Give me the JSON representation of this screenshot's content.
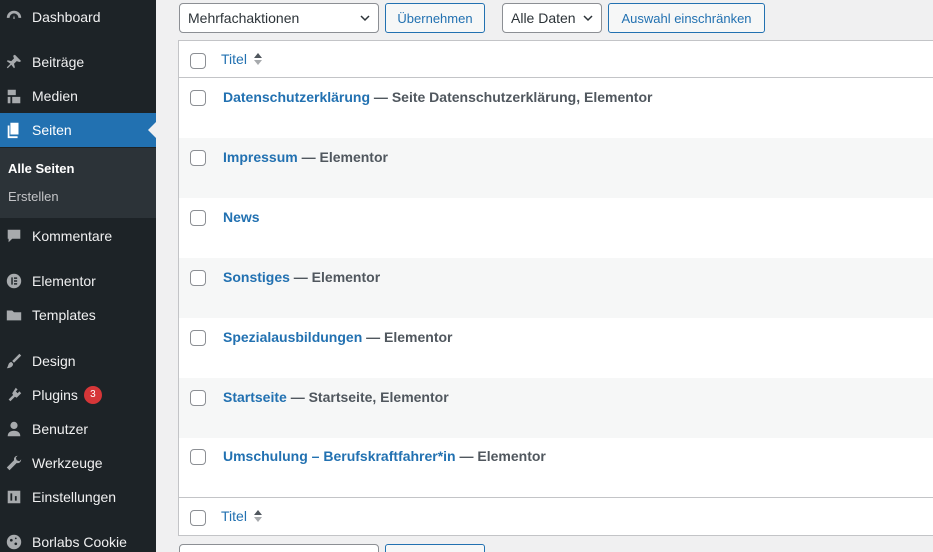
{
  "sidebar": {
    "items": [
      {
        "label": "Dashboard",
        "icon": "dashboard-icon"
      },
      {
        "label": "Beiträge",
        "icon": "pin-icon"
      },
      {
        "label": "Medien",
        "icon": "media-icon"
      },
      {
        "label": "Seiten",
        "icon": "pages-icon",
        "active": true
      },
      {
        "label": "Kommentare",
        "icon": "comment-icon"
      },
      {
        "label": "Elementor",
        "icon": "elementor-icon"
      },
      {
        "label": "Templates",
        "icon": "folder-icon"
      },
      {
        "label": "Design",
        "icon": "brush-icon"
      },
      {
        "label": "Plugins",
        "icon": "plugin-icon",
        "badge": "3"
      },
      {
        "label": "Benutzer",
        "icon": "user-icon"
      },
      {
        "label": "Werkzeuge",
        "icon": "wrench-icon"
      },
      {
        "label": "Einstellungen",
        "icon": "settings-icon"
      },
      {
        "label": "Borlabs Cookie",
        "icon": "cookie-icon"
      }
    ],
    "submenu": [
      {
        "label": "Alle Seiten",
        "current": true
      },
      {
        "label": "Erstellen"
      }
    ]
  },
  "filters": {
    "bulk_action": "Mehrfachaktionen",
    "apply_label": "Übernehmen",
    "date_filter": "Alle Daten",
    "filter_label": "Auswahl einschränken"
  },
  "table": {
    "column_title": "Titel",
    "rows": [
      {
        "title": "Datenschutzerklärung",
        "suffix": " — Seite Datenschutzerklärung, Elementor"
      },
      {
        "title": "Impressum",
        "suffix": " — Elementor"
      },
      {
        "title": "News",
        "suffix": ""
      },
      {
        "title": "Sonstiges",
        "suffix": " — Elementor"
      },
      {
        "title": "Spezialausbildungen",
        "suffix": " — Elementor"
      },
      {
        "title": "Startseite",
        "suffix": " — Startseite, Elementor"
      },
      {
        "title": "Umschulung – Berufskraftfahrer*in",
        "suffix": " — Elementor"
      }
    ]
  },
  "colors": {
    "sidebar_bg": "#1d2327",
    "accent": "#2271b1",
    "badge": "#d63638"
  }
}
